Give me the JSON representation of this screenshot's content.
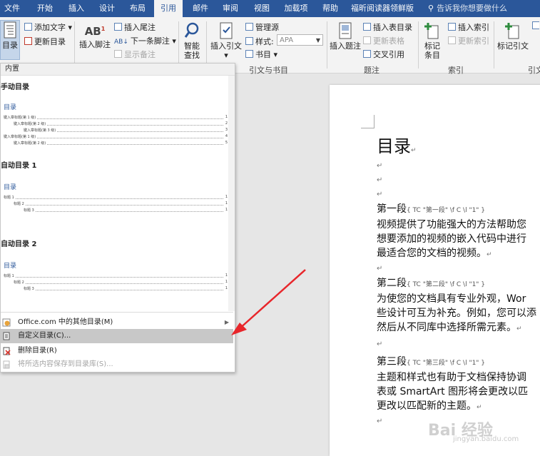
{
  "tabs": [
    "文件",
    "开始",
    "插入",
    "设计",
    "布局",
    "引用",
    "邮件",
    "审阅",
    "视图",
    "加载项",
    "帮助",
    "福昕阅读器领鲜版"
  ],
  "active_tab": "引用",
  "search_text": "告诉我你想要做什么",
  "ribbon": {
    "toc_button": "目录",
    "add_text": "添加文字",
    "update_toc": "更新目录",
    "insert_footnote": "插入脚注",
    "insert_endnote": "插入尾注",
    "next_footnote": "下一条脚注",
    "show_notes": "显示备注",
    "smart_lookup_1": "智能",
    "smart_lookup_2": "查找",
    "insert_citation": "插入引文",
    "manage_sources": "管理源",
    "style_label": "样式:",
    "style_value": "APA",
    "bibliography": "书目",
    "group_citations": "引文与书目",
    "insert_caption": "插入题注",
    "insert_table_of_figures": "插入表目录",
    "update_table": "更新表格",
    "cross_reference": "交叉引用",
    "group_captions": "题注",
    "mark_entry_1": "标记",
    "mark_entry_2": "条目",
    "insert_index": "插入索引",
    "update_index": "更新索引",
    "group_index": "索引",
    "mark_citation": "标记引文",
    "group_cut": "引文"
  },
  "menu": {
    "header": "内置",
    "manual_title": "手动目录",
    "auto1_title": "自动目录 1",
    "auto2_title": "自动目录 2",
    "preview_heading": "目录",
    "manual_lines": [
      {
        "text": "键入章标题(第 1 级)",
        "num": "1"
      },
      {
        "text": "键入章标题(第 2 级)",
        "num": "2"
      },
      {
        "text": "键入章标题(第 3 级)",
        "num": "3"
      },
      {
        "text": "键入章标题(第 1 级)",
        "num": "4"
      },
      {
        "text": "键入章标题(第 2 级)",
        "num": "5"
      }
    ],
    "auto_lines": [
      {
        "text": "标题 1",
        "num": "1"
      },
      {
        "text": "标题 2",
        "num": "1"
      },
      {
        "text": "标题 3",
        "num": "1"
      }
    ],
    "more_toc": "Office.com 中的其他目录(M)",
    "custom_toc": "自定义目录(C)...",
    "remove_toc": "删除目录(R)",
    "save_selection": "将所选内容保存到目录库(S)..."
  },
  "document": {
    "title": "目录",
    "p1_head": "第一段",
    "p1_field": "{ TC \"第一段\" \\f C \\l \"1\" }",
    "p1_lines": [
      "视频提供了功能强大的方法帮助您",
      "想要添加的视频的嵌入代码中进行",
      "最适合您的文档的视频。"
    ],
    "p2_head": "第二段",
    "p2_field": "{ TC \"第二段\" \\f C \\l \"1\" }",
    "p2_lines": [
      "为使您的文档具有专业外观，Wor",
      "些设计可互为补充。例如，您可以添",
      "然后从不同库中选择所需元素。"
    ],
    "p3_head": "第三段",
    "p3_field": "{ TC \"第三段\" \\f C \\l \"1\" }",
    "p3_lines": [
      "主题和样式也有助于文档保持协调",
      "表或 SmartArt 图形将会更改以匹",
      "更改以匹配新的主题。"
    ],
    "para_mark": "↵"
  },
  "watermark": "Bai 经验",
  "watermark_sub": "jingyan.baidu.com",
  "colors": {
    "ribbon_blue": "#2b579a",
    "arrow_red": "#e8262b",
    "highlight": "#c8c8c8"
  }
}
